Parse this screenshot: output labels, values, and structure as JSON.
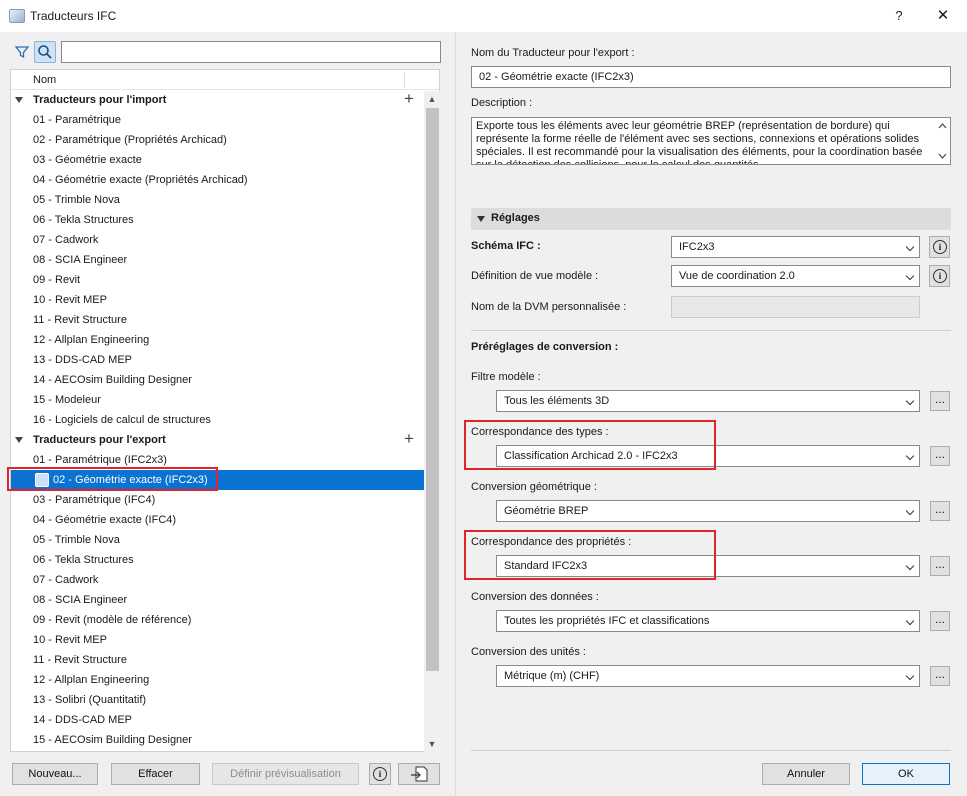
{
  "window": {
    "title": "Traducteurs IFC",
    "help": "?",
    "close": "✕"
  },
  "search": {
    "placeholder": "",
    "value": ""
  },
  "tree": {
    "column_header": "Nom",
    "import_group": "Traducteurs pour l'import",
    "import_items": [
      "01 - Paramétrique",
      "02 - Paramétrique (Propriétés Archicad)",
      "03 - Géométrie exacte",
      "04 - Géométrie exacte (Propriétés Archicad)",
      "05 - Trimble Nova",
      "06 - Tekla Structures",
      "07 - Cadwork",
      "08 - SCIA Engineer",
      "09 - Revit",
      "10 - Revit MEP",
      "11 - Revit Structure",
      "12 - Allplan Engineering",
      "13 - DDS-CAD MEP",
      "14 - AECOsim Building Designer",
      "15 - Modeleur",
      "16 - Logiciels de calcul de structures"
    ],
    "export_group": "Traducteurs pour l'export",
    "export_items": [
      "01 - Paramétrique (IFC2x3)",
      "02 - Géométrie exacte (IFC2x3)",
      "03 - Paramétrique (IFC4)",
      "04 - Géométrie exacte (IFC4)",
      "05 - Trimble Nova",
      "06 - Tekla Structures",
      "07 - Cadwork",
      "08 - SCIA Engineer",
      "09 - Revit (modèle de référence)",
      "10 - Revit MEP",
      "11 - Revit Structure",
      "12 - Allplan Engineering",
      "13 - Solibri (Quantitatif)",
      "14 - DDS-CAD MEP",
      "15 - AECOsim Building Designer"
    ],
    "selected_export_index": 1
  },
  "bottom_left": {
    "new_label": "Nouveau...",
    "delete_label": "Effacer",
    "preview_label": "Définir prévisualisation"
  },
  "details": {
    "name_label": "Nom du Traducteur pour l'export :",
    "name_value": "02 - Géométrie exacte (IFC2x3)",
    "description_label": "Description :",
    "description_text": "Exporte tous les éléments avec leur géométrie BREP (représentation de bordure) qui représente la forme réelle de l'élément avec ses sections, connexions et opérations solides spéciales. Il est recommandé pour la visualisation des éléments, pour la coordination basée sur la détection des collisions, pour le calcul des quantités"
  },
  "settings": {
    "section_label": "Réglages",
    "schema_label": "Schéma IFC :",
    "schema_value": "IFC2x3",
    "mvd_label": "Définition de vue modèle :",
    "mvd_value": "Vue de coordination 2.0",
    "custom_mvd_label": "Nom de la DVM personnalisée :",
    "presets_label": "Préréglages de conversion :",
    "model_filter_label": "Filtre modèle :",
    "model_filter_value": "Tous les éléments 3D",
    "type_mapping_label": "Correspondance des types :",
    "type_mapping_value": "Classification Archicad 2.0 - IFC2x3",
    "geometry_label": "Conversion géométrique :",
    "geometry_value": "Géométrie BREP",
    "property_mapping_label": "Correspondance des propriétés :",
    "property_mapping_value": "Standard IFC2x3",
    "data_label": "Conversion des données :",
    "data_value": "Toutes les propriétés IFC et classifications",
    "units_label": "Conversion des unités :",
    "units_value": "Métrique (m) (CHF)",
    "more_label": "..."
  },
  "dialog_buttons": {
    "cancel_label": "Annuler",
    "ok_label": "OK"
  },
  "colors": {
    "selection": "#0a73d1",
    "highlight": "#e0242b",
    "pane_bg": "#f0f0f0"
  }
}
